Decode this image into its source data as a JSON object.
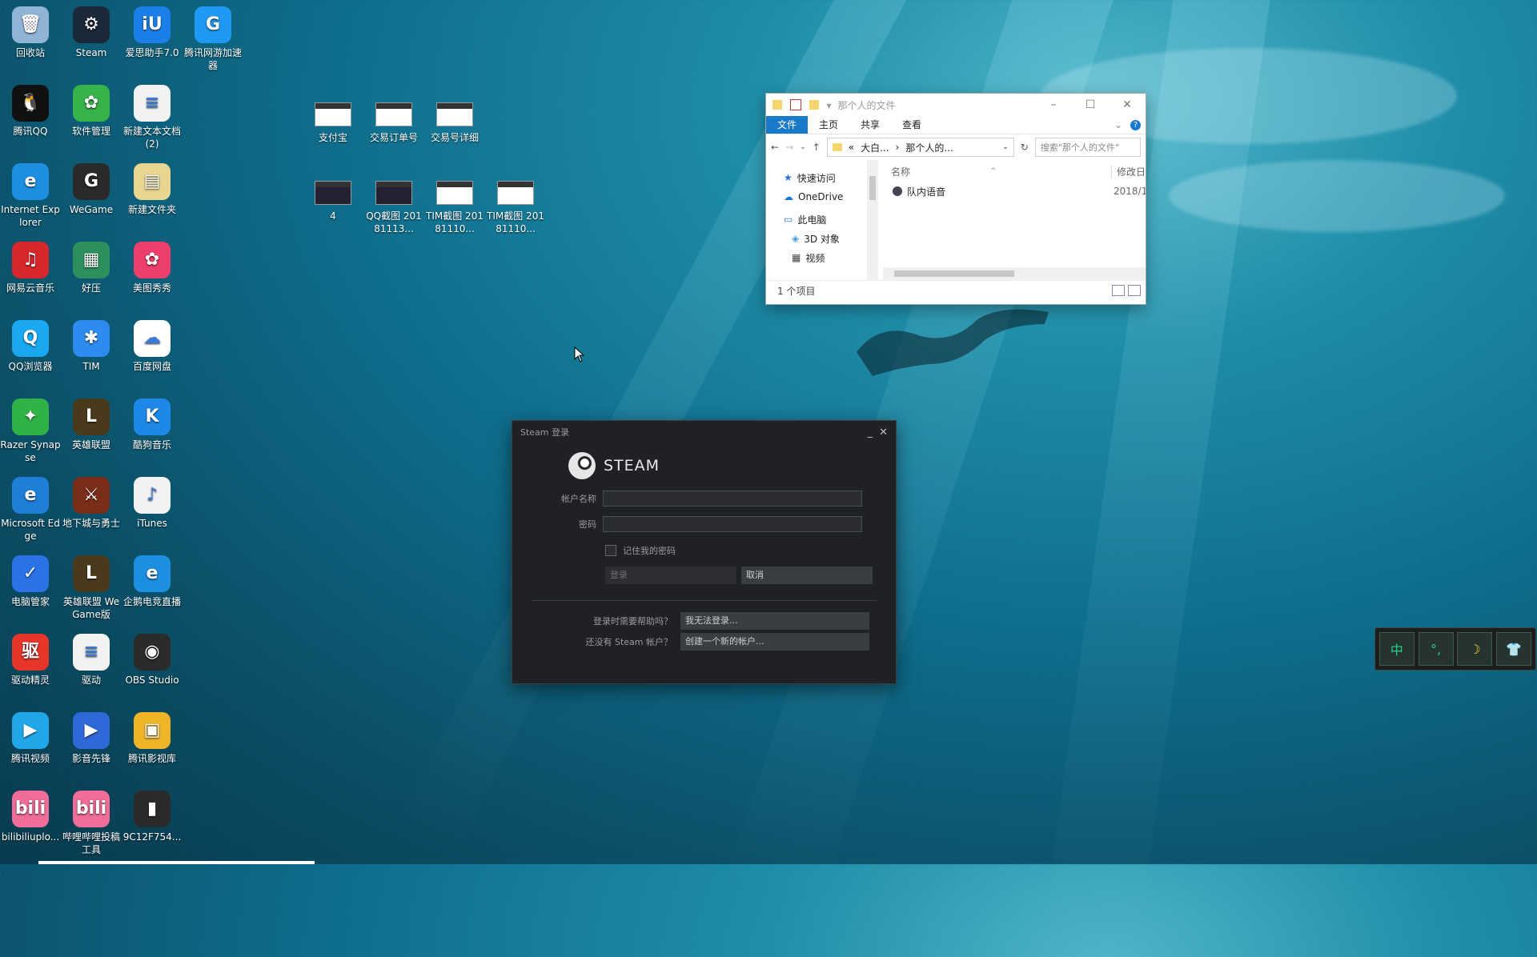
{
  "desktop": {
    "icons": [
      {
        "label": "回收站",
        "color": "#8fb4d6",
        "glyph": "🗑"
      },
      {
        "label": "Steam",
        "color": "#1b2838",
        "glyph": "⚙"
      },
      {
        "label": "爱思助手7.0",
        "color": "#1a7fe8",
        "glyph": "iU"
      },
      {
        "label": "腾讯网游加速器",
        "color": "#1f9af2",
        "glyph": "G"
      },
      {
        "label": "腾讯QQ",
        "color": "#111111",
        "glyph": "🐧"
      },
      {
        "label": "软件管理",
        "color": "#38b24a",
        "glyph": "✿"
      },
      {
        "label": "新建文本文档 (2)",
        "color": "#f2f2f2",
        "glyph": "≡"
      },
      {
        "label": "Internet Explorer",
        "color": "#1d8fe0",
        "glyph": "e"
      },
      {
        "label": "WeGame",
        "color": "#2a2a2a",
        "glyph": "G"
      },
      {
        "label": "新建文件夹",
        "color": "#e8d590",
        "glyph": "▤"
      },
      {
        "label": "网易云音乐",
        "color": "#d7262c",
        "glyph": "♫"
      },
      {
        "label": "好压",
        "color": "#2d8f5b",
        "glyph": "▦"
      },
      {
        "label": "美图秀秀",
        "color": "#ec3f6b",
        "glyph": "✿"
      },
      {
        "label": "QQ浏览器",
        "color": "#1aa8f0",
        "glyph": "Q"
      },
      {
        "label": "TIM",
        "color": "#2e8cf0",
        "glyph": "✱"
      },
      {
        "label": "百度网盘",
        "color": "#ffffff",
        "glyph": "☁"
      },
      {
        "label": "Razer Synapse",
        "color": "#2fb248",
        "glyph": "✦"
      },
      {
        "label": "英雄联盟",
        "color": "#4a3a1c",
        "glyph": "L"
      },
      {
        "label": "酷狗音乐",
        "color": "#1d88e8",
        "glyph": "K"
      },
      {
        "label": "Microsoft Edge",
        "color": "#1f7fd6",
        "glyph": "e"
      },
      {
        "label": "地下城与勇士",
        "color": "#7a2d18",
        "glyph": "⚔"
      },
      {
        "label": "iTunes",
        "color": "#f2f2f2",
        "glyph": "♪"
      },
      {
        "label": "电脑管家",
        "color": "#2a72e5",
        "glyph": "✓"
      },
      {
        "label": "英雄联盟 WeGame版",
        "color": "#4a3a1c",
        "glyph": "L"
      },
      {
        "label": "企鹅电竞直播",
        "color": "#1d8fe0",
        "glyph": "e"
      },
      {
        "label": "驱动精灵",
        "color": "#e8352a",
        "glyph": "驱"
      },
      {
        "label": "驱动",
        "color": "#f2f2f2",
        "glyph": "≡"
      },
      {
        "label": "OBS Studio",
        "color": "#2b2b2b",
        "glyph": "◉"
      },
      {
        "label": "腾讯视频",
        "color": "#1fa7ea",
        "glyph": "▶"
      },
      {
        "label": "影音先锋",
        "color": "#2e69d8",
        "glyph": "▶"
      },
      {
        "label": "腾讯影视库",
        "color": "#f0b428",
        "glyph": "▣"
      },
      {
        "label": "bilibiliuplo...",
        "color": "#f06d9a",
        "glyph": "bili"
      },
      {
        "label": "哔哩哔哩投稿工具",
        "color": "#f06d9a",
        "glyph": "bili"
      },
      {
        "label": "9C12F754...",
        "color": "#2a2a2a",
        "glyph": "▮"
      }
    ],
    "files": [
      {
        "label": "支付宝",
        "dark": false
      },
      {
        "label": "交易订单号",
        "dark": false
      },
      {
        "label": "交易号详细",
        "dark": false
      },
      {
        "label": "4",
        "dark": true
      },
      {
        "label": "QQ截图 20181113...",
        "dark": true
      },
      {
        "label": "TIM截图 20181110...",
        "dark": false
      },
      {
        "label": "TIM截图 20181110...",
        "dark": false
      }
    ]
  },
  "explorer": {
    "title": "那个人的文件",
    "ribbon": [
      "文件",
      "主页",
      "共享",
      "查看"
    ],
    "path": [
      "«",
      "大白...",
      "›",
      "那个人的..."
    ],
    "search_placeholder": "搜索\"那个人的文件\"",
    "nav": [
      {
        "label": "快速访问",
        "sub": false,
        "icon": "star-icon",
        "glyph": "★",
        "color": "#2a6fd6"
      },
      {
        "label": "OneDrive",
        "sub": false,
        "icon": "cloud-icon",
        "glyph": "☁",
        "color": "#1a73d9"
      },
      {
        "label": "此电脑",
        "sub": false,
        "icon": "computer-icon",
        "glyph": "▭",
        "color": "#3a7bd5"
      },
      {
        "label": "3D 对象",
        "sub": true,
        "icon": "cube-icon",
        "glyph": "◈",
        "color": "#3aa0e0"
      },
      {
        "label": "视频",
        "sub": true,
        "icon": "film-icon",
        "glyph": "▦",
        "color": "#444444"
      }
    ],
    "columns": {
      "name": "名称",
      "modified": "修改日"
    },
    "rows": [
      {
        "name": "队内语音",
        "date": "2018/1"
      }
    ],
    "status": "1 个项目"
  },
  "steam": {
    "title": "Steam 登录",
    "logo_text": "STEAM",
    "account_label": "帐户名称",
    "password_label": "密码",
    "remember_label": "记住我的密码",
    "login_button": "登录",
    "cancel_button": "取消",
    "help_question": "登录时需要帮助吗？",
    "help_button": "我无法登录...",
    "create_question": "还没有 Steam 帐户？",
    "create_button": "创建一个新的帐户..."
  },
  "ime": [
    {
      "glyph": "中",
      "color": "#22d18b"
    },
    {
      "glyph": "°,",
      "color": "#22d18b"
    },
    {
      "glyph": "☽",
      "color": "#f1d22b"
    },
    {
      "glyph": "👕",
      "color": "#22d1c8"
    }
  ]
}
